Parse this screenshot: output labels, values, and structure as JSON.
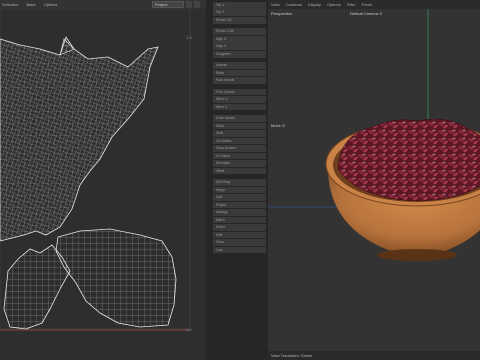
{
  "uv_editor": {
    "menu": [
      "Selection",
      "Bake",
      "Options"
    ],
    "select_value": "Project",
    "corner_labels": [
      "1.0",
      "1.0"
    ]
  },
  "tools": {
    "items": [
      "Flip U",
      "Flip V",
      "Rotate CW",
      "Rotate CCW",
      "Align U",
      "Align V",
      "Straighten",
      "Unwrap",
      "Relax",
      "Pack Islands",
      "Fit to Canvas",
      "Mirror U",
      "Mirror V",
      "Scale Islands",
      "Stitch",
      "Weld",
      "Cut Seams",
      "Show Borders",
      "UV Island",
      "Normalize",
      "Offset",
      "Grid Snap",
      "Merge",
      "Split",
      "Project",
      "Average",
      "Match",
      "Select",
      "Hide",
      "Show",
      "Lock"
    ]
  },
  "viewport": {
    "menu": [
      "View",
      "Cameras",
      "Display",
      "Options",
      "Filter",
      "Panel"
    ],
    "perspective_label": "Perspective",
    "camera_label": "Default Camera ⊙",
    "move_label": "Move ⊙",
    "status": "View Transform: Scene"
  },
  "colors": {
    "accent": "#3fae6a",
    "bowl": "#b8733c",
    "petals": "#7a1f2f"
  }
}
